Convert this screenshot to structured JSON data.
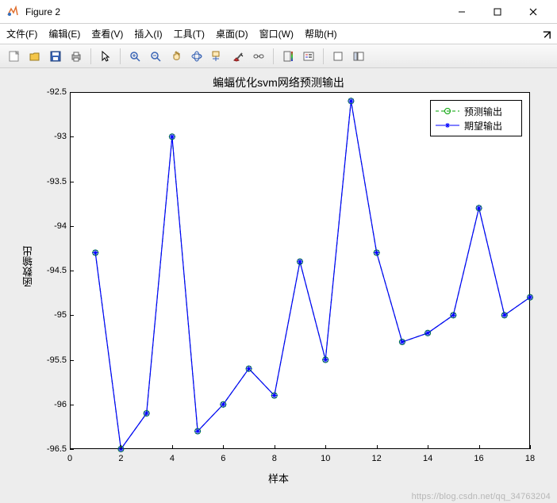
{
  "window": {
    "title": "Figure 2"
  },
  "menus": {
    "file": "文件(F)",
    "edit": "编辑(E)",
    "view": "查看(V)",
    "insert": "插入(I)",
    "tools": "工具(T)",
    "desktop": "桌面(D)",
    "window": "窗口(W)",
    "help": "帮助(H)"
  },
  "chart_data": {
    "type": "line",
    "title": "蝙蝠优化svm网络预测输出",
    "xlabel": "样本",
    "ylabel": "函数输出",
    "xlim": [
      0,
      18
    ],
    "ylim": [
      -96.5,
      -92.5
    ],
    "xticks": [
      0,
      2,
      4,
      6,
      8,
      10,
      12,
      14,
      16,
      18
    ],
    "yticks": [
      -96.5,
      -96,
      -95.5,
      -95,
      -94.5,
      -94,
      -93.5,
      -93,
      -92.5
    ],
    "x": [
      1,
      2,
      3,
      4,
      5,
      6,
      7,
      8,
      9,
      10,
      11,
      12,
      13,
      14,
      15,
      16,
      17,
      18
    ],
    "series": [
      {
        "name": "预测输出",
        "marker": "circle",
        "line_style": "dashed",
        "color": "#00a000",
        "values": [
          -94.3,
          -96.5,
          -96.1,
          -93.0,
          -96.3,
          -96.0,
          -95.6,
          -95.9,
          -94.4,
          -95.5,
          -92.6,
          -94.3,
          -95.3,
          -95.2,
          -95.0,
          -93.8,
          -95.0,
          -94.8
        ]
      },
      {
        "name": "期望输出",
        "marker": "star",
        "line_style": "solid",
        "color": "#0000ff",
        "values": [
          -94.3,
          -96.5,
          -96.1,
          -93.0,
          -96.3,
          -96.0,
          -95.6,
          -95.9,
          -94.4,
          -95.5,
          -92.6,
          -94.3,
          -95.3,
          -95.2,
          -95.0,
          -93.8,
          -95.0,
          -94.8
        ]
      }
    ]
  },
  "watermark": "https://blog.csdn.net/qq_34763204"
}
